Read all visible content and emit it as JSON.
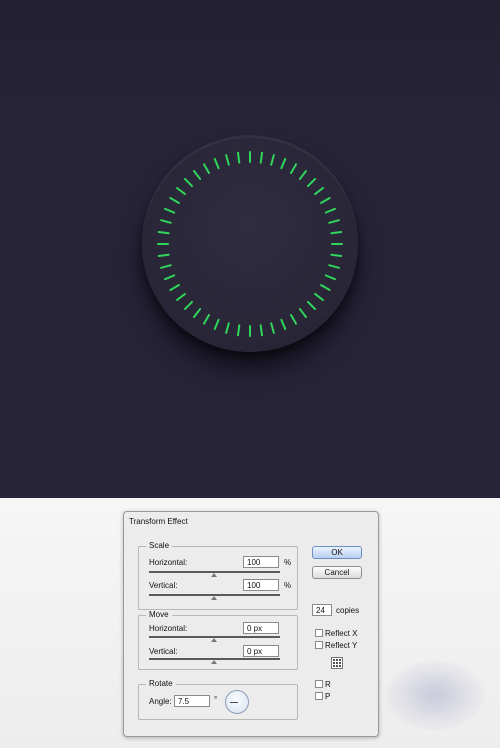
{
  "colors": {
    "background": "#27243a",
    "knob": "#2c293d",
    "tick": "#2fd65a"
  },
  "knob": {
    "tick_count": 48
  },
  "dialog": {
    "title": "Transform Effect",
    "scale": {
      "label": "Scale",
      "horizontal_label": "Horizontal:",
      "horizontal_value": "100",
      "horizontal_unit": "%",
      "vertical_label": "Vertical:",
      "vertical_value": "100",
      "vertical_unit": "%"
    },
    "move": {
      "label": "Move",
      "horizontal_label": "Horizontal:",
      "horizontal_value": "0 px",
      "vertical_label": "Vertical:",
      "vertical_value": "0 px"
    },
    "rotate": {
      "label": "Rotate",
      "angle_label": "Angle:",
      "angle_value": "7.5",
      "degree_symbol": "°"
    },
    "ok_label": "OK",
    "cancel_label": "Cancel",
    "copies_value": "24",
    "copies_label": "copies",
    "reflect_x_label": "Reflect X",
    "reflect_y_label": "Reflect Y",
    "option_r_label": "R",
    "option_p_label": "P"
  }
}
